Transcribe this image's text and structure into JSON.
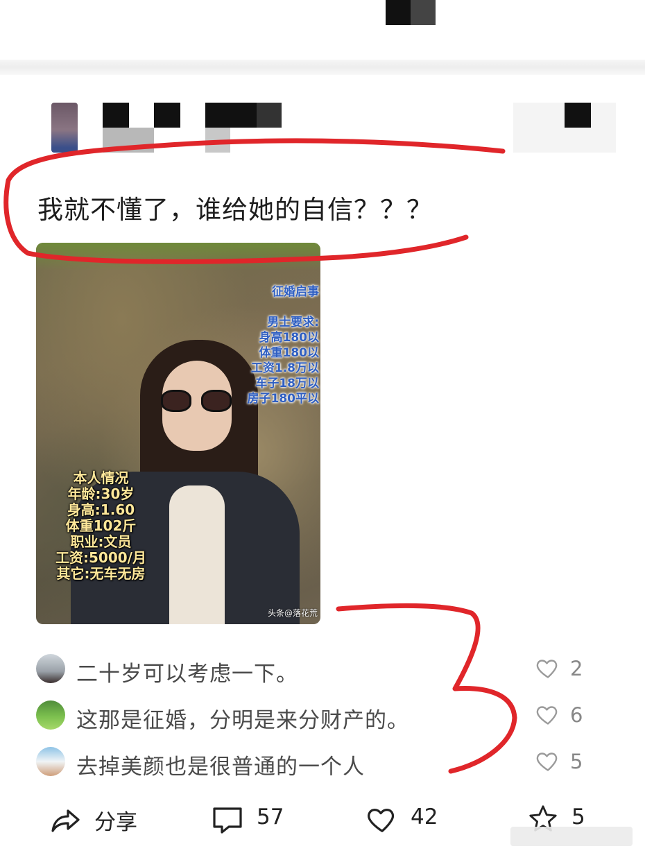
{
  "post": {
    "text": "我就不懂了，谁给她的自信？？？"
  },
  "image": {
    "overlay_right_title": "征婚启事",
    "overlay_right_lines": [
      "男士要求:",
      "身高180以",
      "体重180以",
      "工资1.8万以",
      "车子18万以",
      "房子180平以"
    ],
    "overlay_left_lines": [
      "本人情况",
      "年龄:30岁",
      "身高:1.60",
      "体重102斤",
      "职业:文员",
      "工资:5000/月",
      "其它:无车无房"
    ],
    "watermark": "头条@落花荒"
  },
  "comments": [
    {
      "text": "二十岁可以考虑一下。",
      "likes": "2"
    },
    {
      "text": "这那是征婚，分明是来分财产的。",
      "likes": "6"
    },
    {
      "text": "去掉美颜也是很普通的一个人",
      "likes": "5"
    }
  ],
  "actions": {
    "share_label": "分享",
    "comment_count": "57",
    "like_count": "42",
    "favorite_count": "5"
  },
  "colors": {
    "annotation_red": "#e0262a",
    "overlay_blue": "#2f5fc2",
    "overlay_yellow": "#ffe89a"
  },
  "icons": [
    "share-icon",
    "comment-icon",
    "heart-icon",
    "star-icon"
  ]
}
